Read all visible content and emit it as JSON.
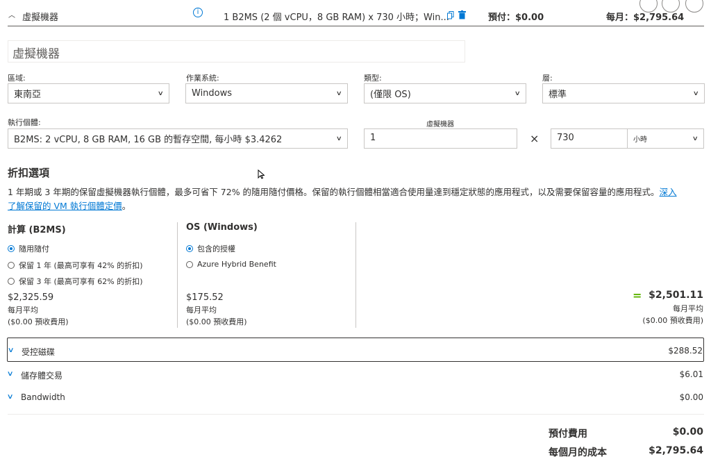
{
  "header": {
    "title": "虛擬機器",
    "summary": "1 B2MS (2 個 vCPU，8 GB RAM) x 730 小時；Win...",
    "upfront": "預付：$0.00",
    "monthly": "每月：$2,795.64",
    "info_icon": "i"
  },
  "name_field": {
    "value": "虛擬機器"
  },
  "fields": {
    "region": {
      "label": "區域:",
      "value": "東南亞"
    },
    "os": {
      "label": "作業系統:",
      "value": "Windows"
    },
    "type": {
      "label": "類型:",
      "value": "(僅限 OS)"
    },
    "tier": {
      "label": "層:",
      "value": "標準"
    },
    "instance": {
      "label": "執行個體:",
      "value": "B2MS: 2 vCPU, 8 GB RAM, 16 GB 的暫存空間, 每小時 $3.4262"
    },
    "vm_count": {
      "label": "虛擬機器",
      "value": "1"
    },
    "times": "×",
    "hours": {
      "value": "730"
    },
    "hours_unit": {
      "value": "小時"
    }
  },
  "discount": {
    "title": "折扣選項",
    "desc_main": "1 年期或 3 年期的保留虛擬機器執行個體，最多可省下 72% 的隨用隨付價格。保留的執行個體相當適合使用量達到穩定狀態的應用程式，以及需要保留容量的應用程式。",
    "link_part1": "深入",
    "link_part2": "了解保留的 VM 執行個體定價",
    "desc_end": "。"
  },
  "compute": {
    "title": "計算 (B2MS)",
    "options": [
      "隨用隨付",
      "保留 1 年 (最高可享有 42% 的折扣)",
      "保留 3 年 (最高可享有 62% 的折扣)"
    ],
    "selected": 0,
    "price": "$2,325.59",
    "price_sub": "每月平均",
    "price_note": "($0.00 預收費用)"
  },
  "os_col": {
    "title": "OS (Windows)",
    "options": [
      "包含的授權",
      "Azure Hybrid Benefit"
    ],
    "selected": 0,
    "price": "$175.52",
    "price_sub": "每月平均",
    "price_note": "($0.00 預收費用)"
  },
  "total": {
    "equals": "=",
    "price": "$2,501.11",
    "sub": "每月平均",
    "note": "($0.00 預收費用)"
  },
  "rows": [
    {
      "label": "受控磁碟",
      "value": "$288.52"
    },
    {
      "label": "儲存體交易",
      "value": "$6.01"
    },
    {
      "label": "Bandwidth",
      "value": "$0.00"
    }
  ],
  "footer": {
    "upfront_label": "預付費用",
    "upfront_value": "$0.00",
    "monthly_label": "每個月的成本",
    "monthly_value": "$2,795.64"
  },
  "colors": {
    "accent": "#0078d4",
    "green": "#5db300"
  }
}
